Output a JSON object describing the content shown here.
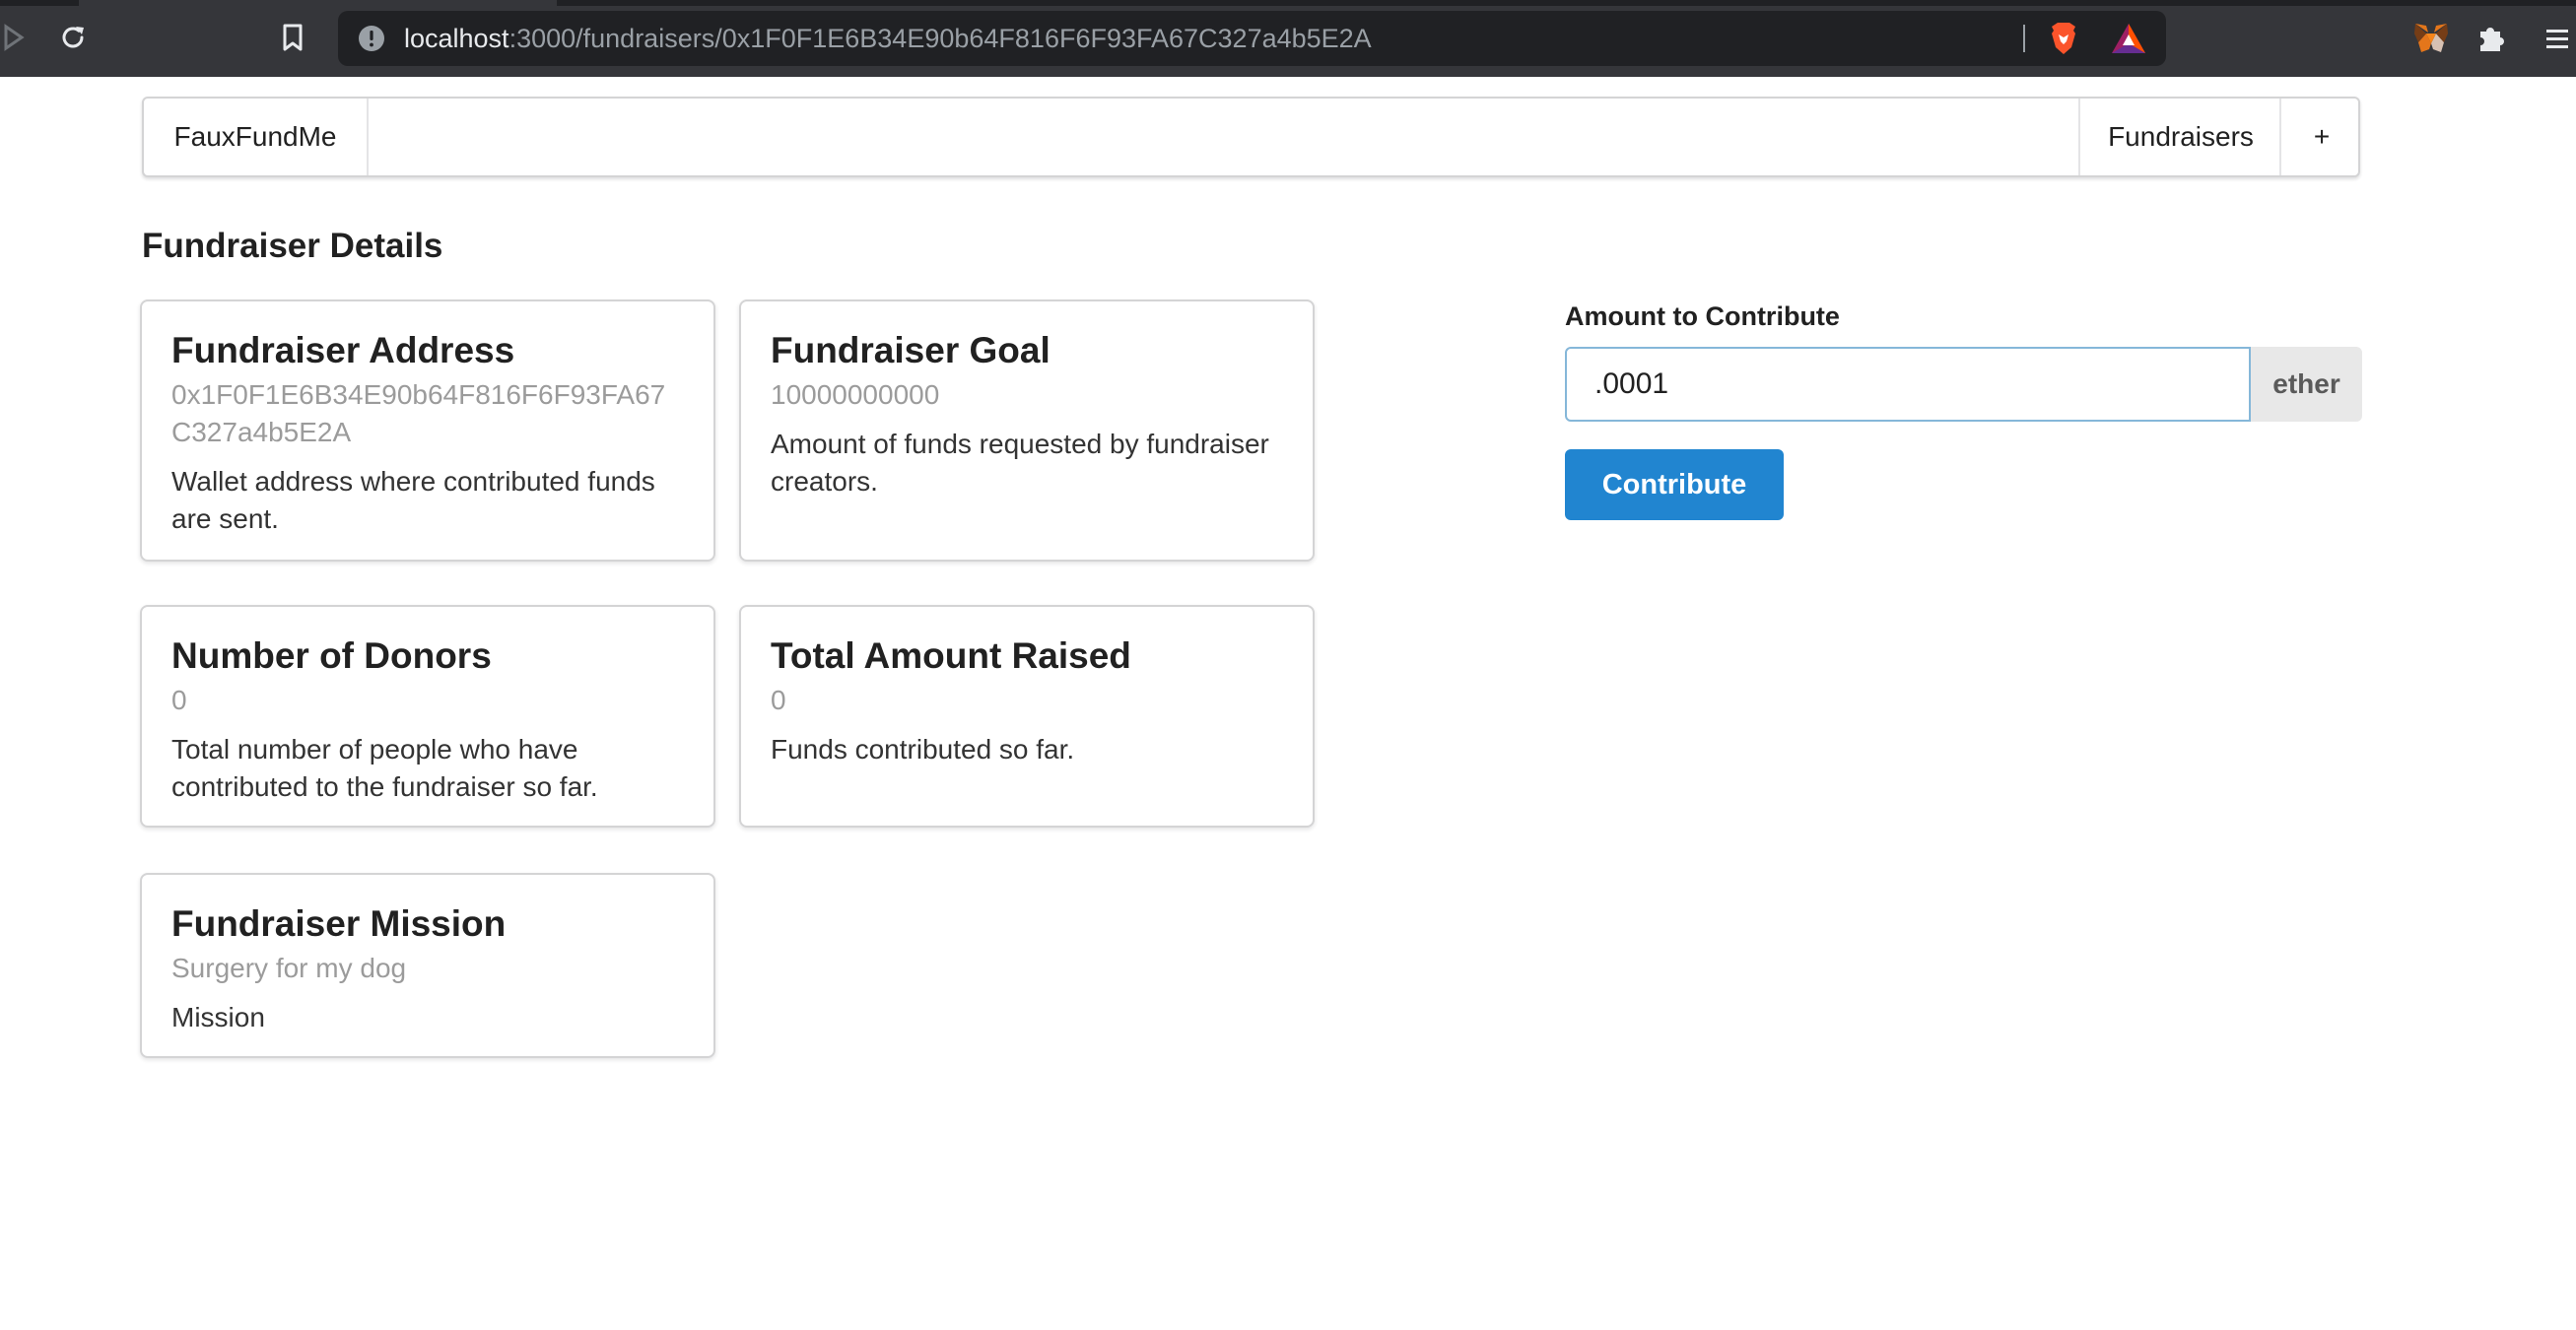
{
  "browser": {
    "url_host": "localhost",
    "url_path": ":3000/fundraisers/0x1F0F1E6B34E90b64F816F6F93FA67C327a4b5E2A"
  },
  "nav": {
    "brand": "FauxFundMe",
    "fundraisers": "Fundraisers",
    "plus": "+"
  },
  "page": {
    "title": "Fundraiser Details"
  },
  "cards": {
    "address": {
      "header": "Fundraiser Address",
      "meta": "0x1F0F1E6B34E90b64F816F6F93FA67C327a4b5E2A",
      "description": "Wallet address where contributed funds are sent."
    },
    "goal": {
      "header": "Fundraiser Goal",
      "meta": "10000000000",
      "description": "Amount of funds requested by fundraiser creators."
    },
    "donors": {
      "header": "Number of Donors",
      "meta": "0",
      "description": "Total number of people who have contributed to the fundraiser so far."
    },
    "raised": {
      "header": "Total Amount Raised",
      "meta": "0",
      "description": "Funds contributed so far."
    },
    "mission": {
      "header": "Fundraiser Mission",
      "meta": "Surgery for my dog",
      "description": "Mission"
    }
  },
  "contribute": {
    "label": "Amount to Contribute",
    "value": ".0001",
    "unit": "ether",
    "button": "Contribute",
    "button_color": "#2185d0"
  }
}
